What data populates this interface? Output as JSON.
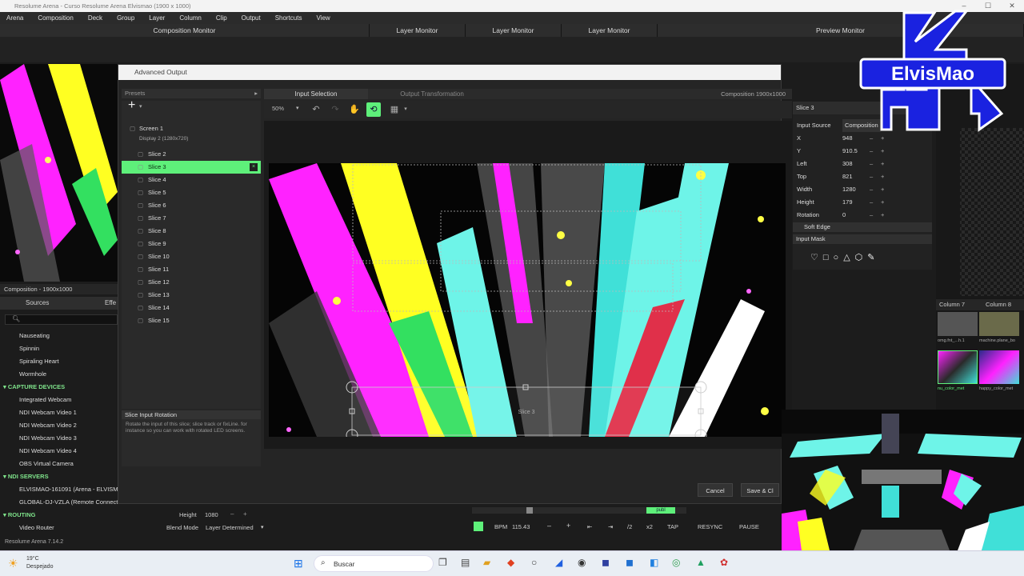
{
  "window": {
    "title": "Resolume Arena - Curso Resolume Arena Elvismao (1900 x 1000)"
  },
  "menu": [
    "Arena",
    "Composition",
    "Deck",
    "Group",
    "Layer",
    "Column",
    "Clip",
    "Output",
    "Shortcuts",
    "View"
  ],
  "monitors": [
    "Composition Monitor",
    "Layer Monitor",
    "Layer Monitor",
    "Layer Monitor",
    "Preview Monitor"
  ],
  "left": {
    "composition_info": "Composition - 1900x1000",
    "tabs": [
      "Sources",
      "Effe"
    ],
    "sources": [
      {
        "label": "Nauseating",
        "group": false
      },
      {
        "label": "Spinnin",
        "group": false
      },
      {
        "label": "Spiraling Heart",
        "group": false
      },
      {
        "label": "Wormhole",
        "group": false
      },
      {
        "label": "CAPTURE DEVICES",
        "group": true
      },
      {
        "label": "Integrated Webcam",
        "group": false
      },
      {
        "label": "NDI Webcam Video 1",
        "group": false
      },
      {
        "label": "NDI Webcam Video 2",
        "group": false
      },
      {
        "label": "NDI Webcam Video 3",
        "group": false
      },
      {
        "label": "NDI Webcam Video 4",
        "group": false
      },
      {
        "label": "OBS Virtual Camera",
        "group": false
      },
      {
        "label": "NDI SERVERS",
        "group": true
      },
      {
        "label": "ELVISMAO-161091 (Arena - ELVISM",
        "group": false
      },
      {
        "label": "GLOBAL-DJ-VZLA (Remote Connecti",
        "group": false
      },
      {
        "label": "ROUTING",
        "group": true
      },
      {
        "label": "Video Router",
        "group": false
      }
    ],
    "status": "Resolume Arena 7.14.2"
  },
  "dialog": {
    "title": "Advanced Output",
    "presets_label": "Presets",
    "tabs": [
      "Input Selection",
      "Output Transformation"
    ],
    "composition_size": "Composition 1900x1000",
    "zoom": "50%",
    "tree": {
      "screen": "Screen 1",
      "display": "Display 2 (1280x720)",
      "slices": [
        "Slice 2",
        "Slice 3",
        "Slice 4",
        "Slice 5",
        "Slice 6",
        "Slice 7",
        "Slice 8",
        "Slice 9",
        "Slice 10",
        "Slice 11",
        "Slice 12",
        "Slice 13",
        "Slice 14",
        "Slice 15"
      ],
      "selected_index": 1
    },
    "info": {
      "title": "Slice Input Rotation",
      "text": "Rotate the input of this slice; slice track or fixLine. for instance so you can work with rotated LED screens."
    },
    "stage_label": "Slice 3",
    "properties": {
      "title": "Slice 3",
      "input_source_label": "Input Source",
      "input_source_value": "Composition",
      "rows": [
        {
          "label": "X",
          "value": "948"
        },
        {
          "label": "Y",
          "value": "910.5"
        },
        {
          "label": "Left",
          "value": "308"
        },
        {
          "label": "Top",
          "value": "821"
        },
        {
          "label": "Width",
          "value": "1280"
        },
        {
          "label": "Height",
          "value": "179"
        },
        {
          "label": "Rotation",
          "value": "0"
        }
      ],
      "soft_edge": "Soft Edge",
      "input_mask": "Input Mask"
    },
    "cancel": "Cancel",
    "save": "Save & Cl"
  },
  "right": {
    "columns": [
      "Column 7",
      "Column 8"
    ],
    "clips": [
      "omg.fnt_...h.1",
      "machine.plane_bo",
      "nu_color_met",
      "happy_color_met"
    ]
  },
  "bottom": {
    "height_label": "Height",
    "height_value": "1080",
    "blend_label": "Blend Mode",
    "blend_value": "Layer Determined",
    "bpm_label": "BPM",
    "bpm_value": "115.43",
    "half": "/2",
    "double": "x2",
    "tap": "TAP",
    "resync": "RESYNC",
    "pause": "PAUSE",
    "puls": "publ"
  },
  "taskbar": {
    "temp": "19°C",
    "weather": "Despejado",
    "search": "Buscar"
  },
  "logo_text": "ElvisMao",
  "colors": {
    "selection": "#5ef07a",
    "accent_blue": "#1a22e0",
    "group_green": "#7ee28a"
  }
}
